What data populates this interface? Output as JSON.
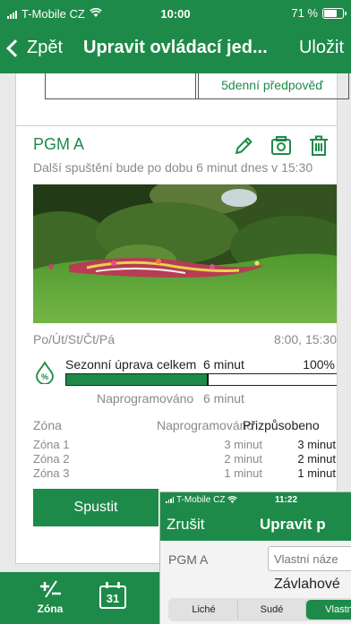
{
  "status": {
    "carrier": "T-Mobile CZ",
    "time": "10:00",
    "battery": "71 %"
  },
  "nav": {
    "back_label": "Zpět",
    "title": "Upravit ovládací jed...",
    "save_label": "Uložit"
  },
  "forecast": {
    "label": "5denní předpověď"
  },
  "program": {
    "name": "PGM A",
    "next_run": "Další spuštění bude po dobu 6 minut dnes v 15:30",
    "days": "Po/Út/St/Čt/Pá",
    "times": "8:00, 15:30",
    "adjust_label": "Sezonní úprava celkem",
    "adjust_minutes": "6 minut",
    "adjust_percent": "100%",
    "adjust_progress": 0.52,
    "programmed_label": "Naprogramováno",
    "programmed_minutes": "6 minut",
    "zone_header": {
      "zone": "Zóna",
      "programmed": "Naprogramováno",
      "adjusted": "Přizpůsobeno"
    },
    "zones": [
      {
        "name": "Zóna 1",
        "programmed": "3 minut",
        "adjusted": "3 minut"
      },
      {
        "name": "Zóna 2",
        "programmed": "2 minut",
        "adjusted": "2 minut"
      },
      {
        "name": "Zóna 3",
        "programmed": "1 minut",
        "adjusted": "1 minut"
      }
    ],
    "start_label": "Spustit"
  },
  "tabbar": {
    "zone_label": "Zóna",
    "calendar_day": "31"
  },
  "overlay": {
    "status": {
      "carrier": "T-Mobile CZ",
      "time": "11:22"
    },
    "cancel_label": "Zrušit",
    "title": "Upravit p",
    "pgm_label": "PGM A",
    "name_placeholder": "Vlastní náze",
    "section_label": "Závlahové",
    "segments": [
      "Liché",
      "Sudé",
      "Vlastní"
    ],
    "active_segment": 2
  },
  "colors": {
    "brand": "#1e8a49",
    "muted": "#8a8a8a",
    "background": "#e9e9e9"
  },
  "icons": [
    "wifi-icon",
    "battery-icon",
    "chevron-left-icon",
    "pencil-icon",
    "camera-icon",
    "trash-icon",
    "percent-drop-icon",
    "plus-minus-icon",
    "calendar-icon"
  ]
}
